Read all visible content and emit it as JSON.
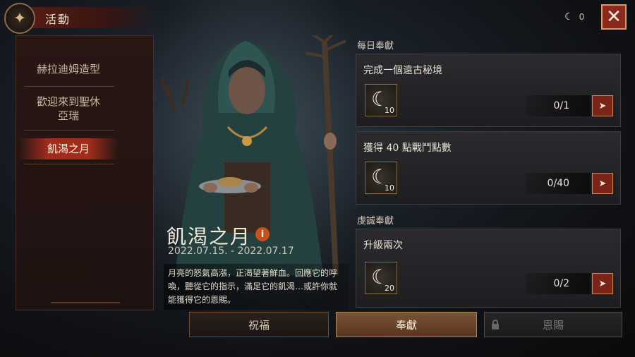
{
  "header": {
    "title": "活動",
    "moon_count": "0"
  },
  "sidebar": {
    "items": [
      {
        "label": "赫拉迪姆造型"
      },
      {
        "label": "歡迎來到聖休\n亞瑞"
      },
      {
        "label": "飢渴之月"
      }
    ]
  },
  "event": {
    "title": "飢渴之月",
    "dates": "2022.07.15. - 2022.07.17",
    "description": "月亮的怒氣高漲，正渴望著鮮血。回應它的呼喚，聽從它的指示，滿足它的飢渴…或許你就能獲得它的恩賜。"
  },
  "sections": {
    "daily": "每日奉獻",
    "pious": "虔誠奉獻"
  },
  "tasks": [
    {
      "title": "完成一個遠古秘境",
      "reward_qty": "10",
      "progress": "0/1"
    },
    {
      "title": "獲得 40 點戰鬥點數",
      "reward_qty": "10",
      "progress": "0/40"
    },
    {
      "title": "升級兩次",
      "reward_qty": "20",
      "progress": "0/2"
    }
  ],
  "tabs": {
    "bless": "祝福",
    "devotion": "奉獻",
    "grace": "恩賜"
  },
  "colors": {
    "accent_red": "#8b2a1c",
    "tab_active": "#7a5336",
    "panel": "#2b2b2e"
  },
  "icons": {
    "emblem": "compass-star-icon",
    "close": "close-icon",
    "moon": "crescent-moon-icon",
    "go": "arrow-go-icon",
    "info": "info-icon",
    "lock": "lock-icon"
  }
}
